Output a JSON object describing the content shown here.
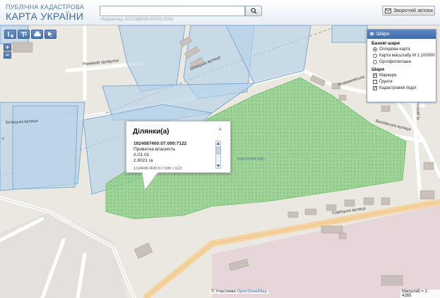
{
  "header": {
    "logo_top": "ПУБЛІЧНА КАДАСТРОВА",
    "logo_main": "КАРТА УКРАЇНИ",
    "search_value": "",
    "search_hint": "Наприклад: 3221089000:00:001:0002",
    "feedback_label": "Зворотній зв'язок"
  },
  "map": {
    "roads": {
      "rozhevyi": "Рожевий провулок",
      "bilytska_top": "Білицька вулиця",
      "bilytska_left": "Білицька вулиця",
      "rozvazhevska": "Розважевська",
      "valkivska": "Валківська вулиця",
      "sirytska": "Сирецька вулиця",
      "podilska": "Подільський пр.",
      "parcel_caption": "Кадастровий поділ"
    }
  },
  "popup": {
    "title": "Ділянки(а)",
    "close": "×",
    "cadastral": "1024087400:07:000:7122",
    "ownership": "Приватна власність",
    "purpose": "А.01.01",
    "area": "2.8021 га",
    "next_cadastral": "1024087400:07:000:7123"
  },
  "layers_panel": {
    "title": "Шари",
    "base_title": "Базові шари",
    "base_options": [
      {
        "label": "Оглядова карта",
        "selected": true
      },
      {
        "label": "Карта масштабу М 1:100000",
        "selected": false
      },
      {
        "label": "Ортофотоплани",
        "selected": false
      }
    ],
    "layers_title": "Шари",
    "layer_options": [
      {
        "label": "Маркери",
        "checked": true
      },
      {
        "label": "Ґрунти",
        "checked": false
      },
      {
        "label": "Кадастровий поділ",
        "checked": true
      }
    ]
  },
  "footer": {
    "attribution_prefix": "© Участники",
    "attribution_link": "OpenStreetMap",
    "scale": "Масштаб = 1 : 4265"
  },
  "toolbar": {
    "tools": [
      "layers-tool-icon",
      "filter-tool-icon",
      "print-icon",
      "pointer-icon"
    ],
    "zoom_in": "+",
    "zoom_out": "−"
  },
  "colors": {
    "parcel_fill": "#b7d3ea",
    "parcel_stroke": "#7ea9d1",
    "highlight_fill": "#8fcf8a",
    "road_main": "#f6d7a3",
    "header_text": "#3a6aa6"
  }
}
